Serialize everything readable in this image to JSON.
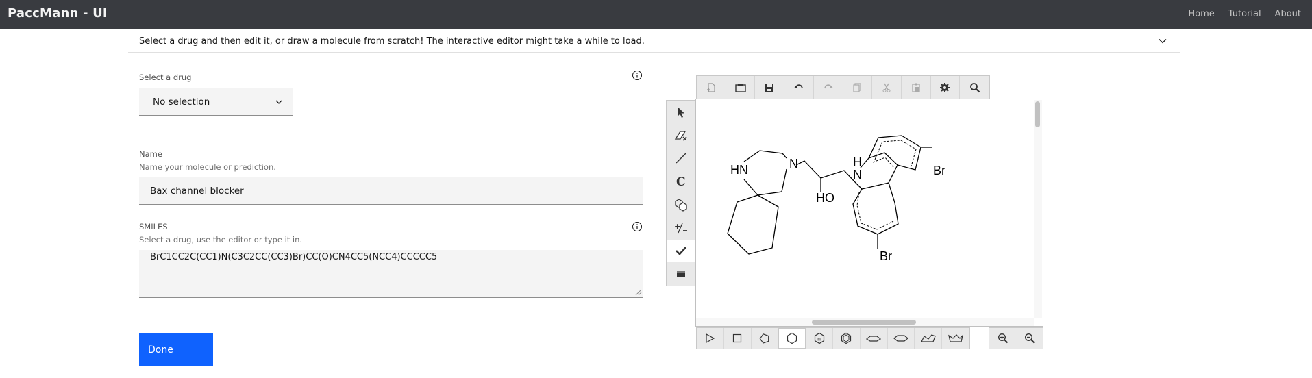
{
  "app": {
    "title": "PaccMann - UI"
  },
  "nav": {
    "home": "Home",
    "tutorial": "Tutorial",
    "about": "About"
  },
  "notice": {
    "text": "Select a drug and then edit it, or draw a molecule from scratch! The interactive editor might take a while to load."
  },
  "drug_select": {
    "label": "Select a drug",
    "value": "No selection"
  },
  "name_field": {
    "label": "Name",
    "helper": "Name your molecule or prediction.",
    "value": "Bax channel blocker"
  },
  "smiles_field": {
    "label": "SMILES",
    "helper": "Select a drug, use the editor or type it in.",
    "value": "BrC1CC2C(CC1)N(C3C2CC(CC3)Br)CC(O)CN4CC5(NCC4)CCCCC5"
  },
  "done_button": {
    "label": "Done"
  },
  "editor": {
    "top_toolbar": [
      "new-icon",
      "open-icon",
      "save-icon",
      "undo-icon",
      "redo-icon",
      "copy-icon",
      "cut-icon",
      "paste-icon",
      "settings-icon",
      "search-icon"
    ],
    "left_toolbar": [
      "select-icon",
      "eraser-icon",
      "bond-icon",
      "chain-icon",
      "template-icon",
      "charge-icon",
      "check-icon",
      "atom-block-icon"
    ],
    "bottom_toolbar": [
      "cyclopropane-icon",
      "cyclobutane-icon",
      "cyclopentane-icon",
      "cyclohexane-icon",
      "cycloheptane-icon",
      "benzene-icon",
      "chair-up-icon",
      "chair-down-icon",
      "ring-conformer-1-icon",
      "ring-conformer-2-icon"
    ],
    "zoom": [
      "zoom-in-icon",
      "zoom-out-icon"
    ],
    "molecule_labels": {
      "hn": "HN",
      "n": "N",
      "ho": "HO",
      "nh_h": "H",
      "nh_n": "N",
      "br1": "Br",
      "br2": "Br"
    }
  },
  "colors": {
    "topbar": "#393b40",
    "primary": "#0f62fe",
    "field_bg": "#f4f4f4"
  }
}
